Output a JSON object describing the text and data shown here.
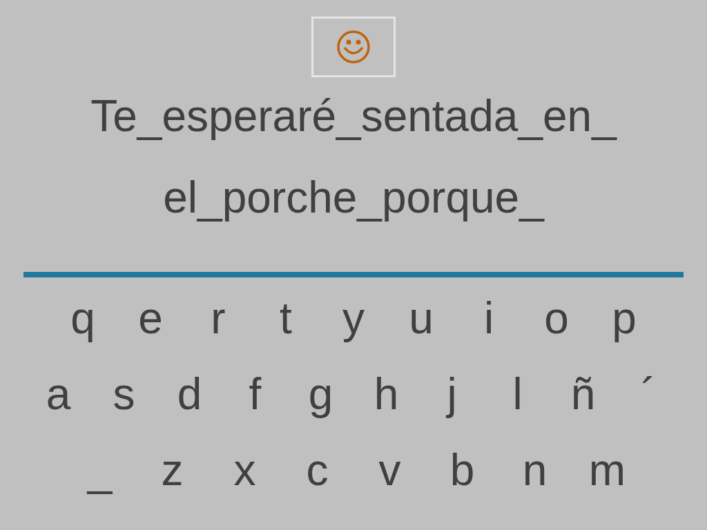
{
  "phrase_lines": [
    "Te_esperaré_sentada_en_",
    "el_porche_porque_"
  ],
  "keyboard_rows": [
    [
      "q",
      "e",
      "r",
      "t",
      "y",
      "u",
      "i",
      "o",
      "p"
    ],
    [
      "a",
      "s",
      "d",
      "f",
      "g",
      "h",
      "j",
      "l",
      "ñ",
      "´"
    ],
    [
      "_",
      "z",
      "x",
      "c",
      "v",
      "b",
      "n",
      "m"
    ]
  ]
}
